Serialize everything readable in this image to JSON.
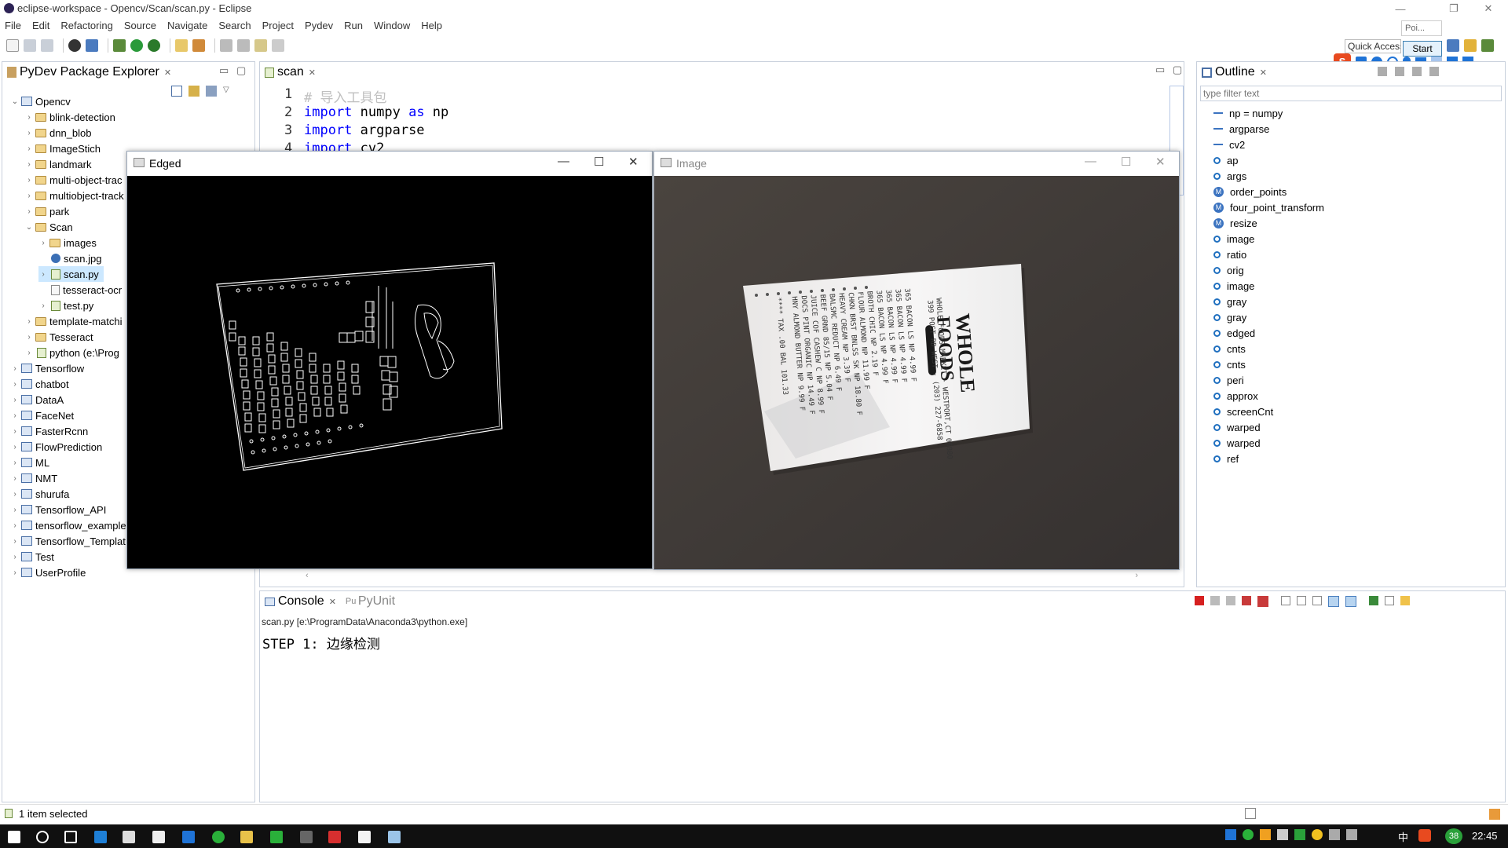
{
  "window": {
    "title": "eclipse-workspace - Opencv/Scan/scan.py - Eclipse",
    "controls": [
      "—",
      "❐",
      "✕"
    ]
  },
  "menu": [
    "File",
    "Edit",
    "Refactoring",
    "Source",
    "Navigate",
    "Search",
    "Project",
    "Pydev",
    "Run",
    "Window",
    "Help"
  ],
  "toolbar": {
    "quick_access": "Quick Access",
    "start": "Start",
    "poi": "Poi..."
  },
  "explorer": {
    "title": "PyDev Package Explorer",
    "items": [
      {
        "label": "Opencv",
        "level": 0,
        "icon": "project",
        "expanded": true
      },
      {
        "label": "blink-detection",
        "level": 1,
        "icon": "folder"
      },
      {
        "label": "dnn_blob",
        "level": 1,
        "icon": "folder"
      },
      {
        "label": "ImageStich",
        "level": 1,
        "icon": "folder"
      },
      {
        "label": "landmark",
        "level": 1,
        "icon": "folder"
      },
      {
        "label": "multi-object-trac",
        "level": 1,
        "icon": "folder"
      },
      {
        "label": "multiobject-track",
        "level": 1,
        "icon": "folder"
      },
      {
        "label": "park",
        "level": 1,
        "icon": "folder"
      },
      {
        "label": "Scan",
        "level": 1,
        "icon": "folder",
        "expanded": true
      },
      {
        "label": "images",
        "level": 2,
        "icon": "folder"
      },
      {
        "label": "scan.jpg",
        "level": 2,
        "icon": "image"
      },
      {
        "label": "scan.py",
        "level": 2,
        "icon": "py",
        "selected": true
      },
      {
        "label": "tesseract-ocr",
        "level": 2,
        "icon": "file"
      },
      {
        "label": "test.py",
        "level": 2,
        "icon": "py"
      },
      {
        "label": "template-matchi",
        "level": 1,
        "icon": "folder"
      },
      {
        "label": "Tesseract",
        "level": 1,
        "icon": "folder"
      },
      {
        "label": "python  (e:\\Prog",
        "level": 1,
        "icon": "py"
      },
      {
        "label": "Tensorflow",
        "level": 0,
        "icon": "project"
      },
      {
        "label": "chatbot",
        "level": 0,
        "icon": "project"
      },
      {
        "label": "DataA",
        "level": 0,
        "icon": "project"
      },
      {
        "label": "FaceNet",
        "level": 0,
        "icon": "project"
      },
      {
        "label": "FasterRcnn",
        "level": 0,
        "icon": "project"
      },
      {
        "label": "FlowPrediction",
        "level": 0,
        "icon": "project"
      },
      {
        "label": "ML",
        "level": 0,
        "icon": "project"
      },
      {
        "label": "NMT",
        "level": 0,
        "icon": "project"
      },
      {
        "label": "shurufa",
        "level": 0,
        "icon": "project"
      },
      {
        "label": "Tensorflow_API",
        "level": 0,
        "icon": "project"
      },
      {
        "label": "tensorflow_example",
        "level": 0,
        "icon": "project"
      },
      {
        "label": "Tensorflow_Templat",
        "level": 0,
        "icon": "project"
      },
      {
        "label": "Test",
        "level": 0,
        "icon": "project"
      },
      {
        "label": "UserProfile",
        "level": 0,
        "icon": "project"
      }
    ]
  },
  "editor": {
    "tab": "scan",
    "lines": [
      {
        "num": "1",
        "comment": "# 导入工具包"
      },
      {
        "num": "2",
        "kw": "import",
        "rest": " numpy ",
        "kw2": "as",
        "rest2": " np"
      },
      {
        "num": "3",
        "kw": "import",
        "rest": " argparse"
      },
      {
        "num": "4",
        "kw": "import",
        "rest": " cv2"
      }
    ]
  },
  "outline": {
    "title": "Outline",
    "filter_placeholder": "type filter text",
    "items": [
      {
        "label": "np = numpy",
        "kind": "import"
      },
      {
        "label": "argparse",
        "kind": "import"
      },
      {
        "label": "cv2",
        "kind": "import"
      },
      {
        "label": "ap",
        "kind": "var"
      },
      {
        "label": "args",
        "kind": "var"
      },
      {
        "label": "order_points",
        "kind": "func"
      },
      {
        "label": "four_point_transform",
        "kind": "func"
      },
      {
        "label": "resize",
        "kind": "func"
      },
      {
        "label": "image",
        "kind": "var"
      },
      {
        "label": "ratio",
        "kind": "var"
      },
      {
        "label": "orig",
        "kind": "var"
      },
      {
        "label": "image",
        "kind": "var"
      },
      {
        "label": "gray",
        "kind": "var"
      },
      {
        "label": "gray",
        "kind": "var"
      },
      {
        "label": "edged",
        "kind": "var"
      },
      {
        "label": "cnts",
        "kind": "var"
      },
      {
        "label": "cnts",
        "kind": "var"
      },
      {
        "label": "peri",
        "kind": "var"
      },
      {
        "label": "approx",
        "kind": "var"
      },
      {
        "label": "screenCnt",
        "kind": "var"
      },
      {
        "label": "warped",
        "kind": "var"
      },
      {
        "label": "warped",
        "kind": "var"
      },
      {
        "label": "ref",
        "kind": "var"
      }
    ]
  },
  "edged_window": {
    "title": "Edged"
  },
  "image_window": {
    "title": "Image"
  },
  "console": {
    "tab": "Console",
    "tab2": "PyUnit",
    "path": "scan.py [e:\\ProgramData\\Anaconda3\\python.exe]",
    "output": "STEP 1: 边缘检测"
  },
  "status": {
    "text": "1 item selected"
  },
  "taskbar": {
    "time": "22:45",
    "ime": "中",
    "badge": "38"
  },
  "colors": {
    "accent": "#0078d7",
    "folder": "#f1d58c",
    "selection": "#cce8ff"
  }
}
